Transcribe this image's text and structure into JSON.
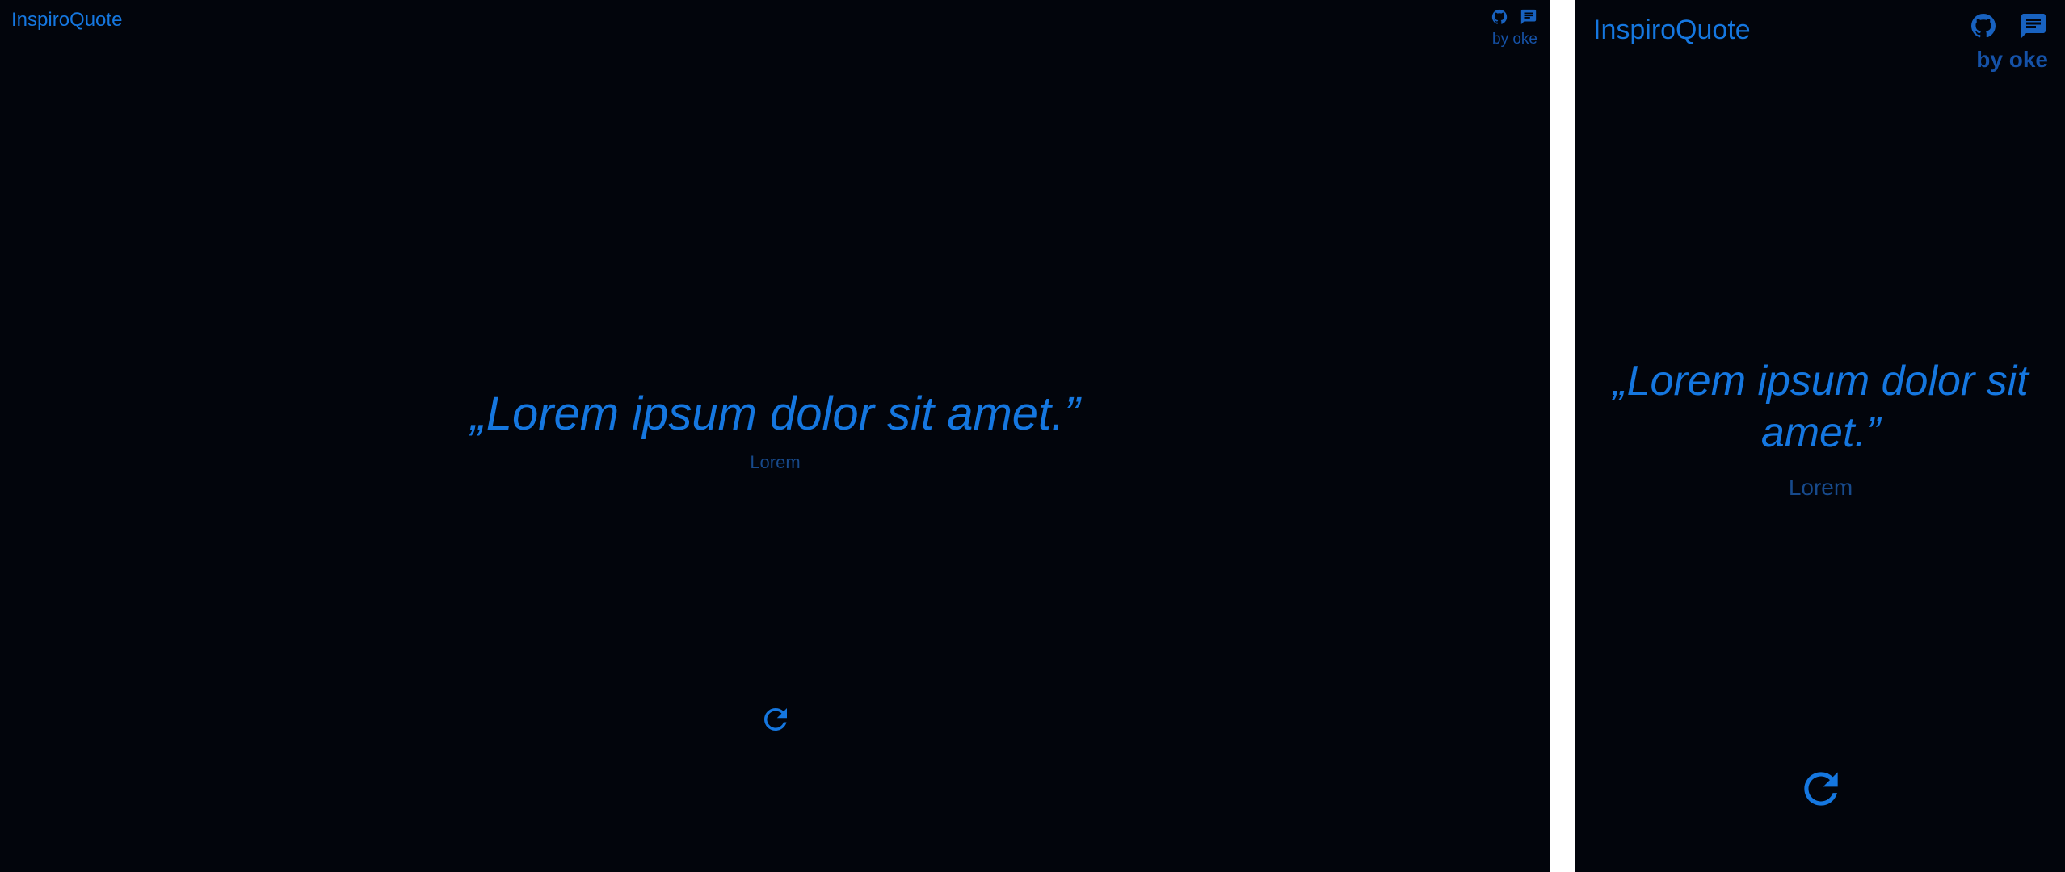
{
  "app": {
    "title": "InspiroQuote",
    "byline": "by oke"
  },
  "quote": {
    "text": "„Lorem ipsum dolor sit amet.”",
    "author": "Lorem"
  },
  "icons": {
    "github": "github-icon",
    "feedback": "message-icon",
    "refresh": "refresh-icon"
  },
  "colors": {
    "background": "#02050c",
    "accent": "#1577e0",
    "muted": "#174a8c"
  }
}
